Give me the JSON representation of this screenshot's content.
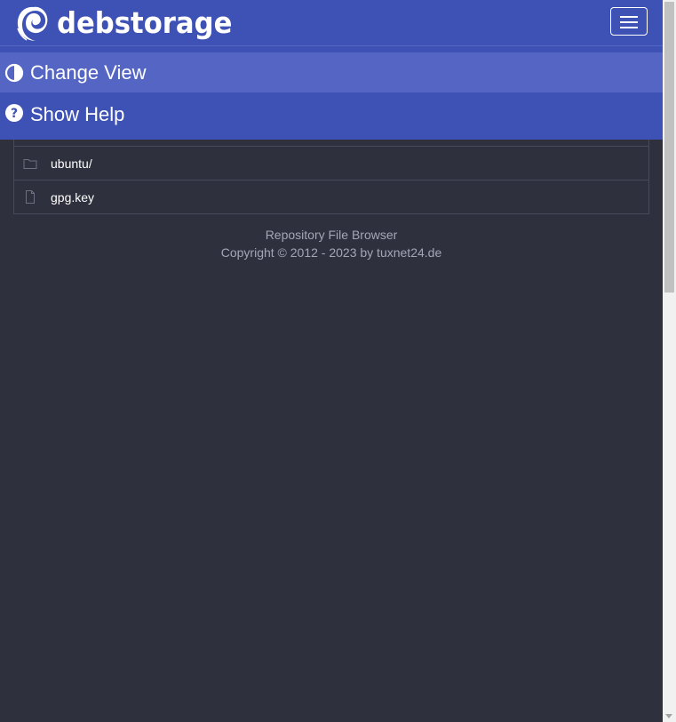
{
  "navbar": {
    "brand_name": "debstorage",
    "brand_logo_icon": "debian-swirl-icon",
    "toggle_icon": "hamburger-menu-icon",
    "background_color": "#3e51b5"
  },
  "menu": {
    "items": [
      {
        "label": "Change View",
        "icon": "half-circle-contrast-icon",
        "active": true
      },
      {
        "label": "Show Help",
        "icon": "question-circle-icon",
        "active": false
      }
    ],
    "active_color": "#5565c4"
  },
  "files": {
    "rows": [
      {
        "name": "ubuntu/",
        "icon": "folder-icon"
      },
      {
        "name": "gpg.key",
        "icon": "file-icon"
      }
    ]
  },
  "footer": {
    "line1": "Repository File Browser",
    "line2": "Copyright © 2012 - 2023 by tuxnet24.de"
  },
  "colors": {
    "page_background": "#2e303d",
    "text_muted": "#a3a6b6",
    "border": "#474a5a"
  }
}
